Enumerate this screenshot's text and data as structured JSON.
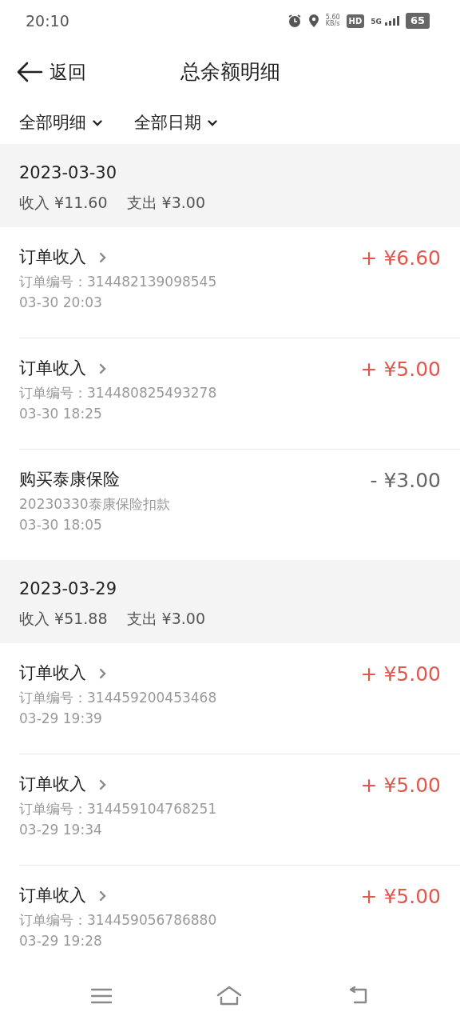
{
  "status_bar": {
    "time": "20:10",
    "speed": "5.60",
    "speed_unit": "KB/s",
    "hd": "HD",
    "network": "5G",
    "battery": "65"
  },
  "header": {
    "back": "返回",
    "title": "总余额明细"
  },
  "filters": [
    {
      "label": "全部明细"
    },
    {
      "label": "全部日期"
    }
  ],
  "groups": [
    {
      "date": "2023-03-30",
      "income": "收入 ¥11.60",
      "expense": "支出 ¥3.00",
      "items": [
        {
          "kind": "order",
          "title": "订单收入",
          "detail": "订单编号：314482139098545",
          "time": "03-30 20:03",
          "amount": "+ ¥6.60"
        },
        {
          "kind": "order",
          "title": "订单收入",
          "detail": "订单编号：314480825493278",
          "time": "03-30 18:25",
          "amount": "+ ¥5.00"
        },
        {
          "kind": "deduction",
          "title": "购买泰康保险",
          "detail": "20230330泰康保险扣款",
          "time": "03-30 18:05",
          "amount": "- ¥3.00"
        }
      ]
    },
    {
      "date": "2023-03-29",
      "income": "收入 ¥51.88",
      "expense": "支出 ¥3.00",
      "items": [
        {
          "kind": "order",
          "title": "订单收入",
          "detail": "订单编号：314459200453468",
          "time": "03-29 19:39",
          "amount": "+ ¥5.00"
        },
        {
          "kind": "order",
          "title": "订单收入",
          "detail": "订单编号：314459104768251",
          "time": "03-29 19:34",
          "amount": "+ ¥5.00"
        },
        {
          "kind": "order",
          "title": "订单收入",
          "detail": "订单编号：314459056786880",
          "time": "03-29 19:28",
          "amount": "+ ¥5.00"
        }
      ]
    }
  ]
}
